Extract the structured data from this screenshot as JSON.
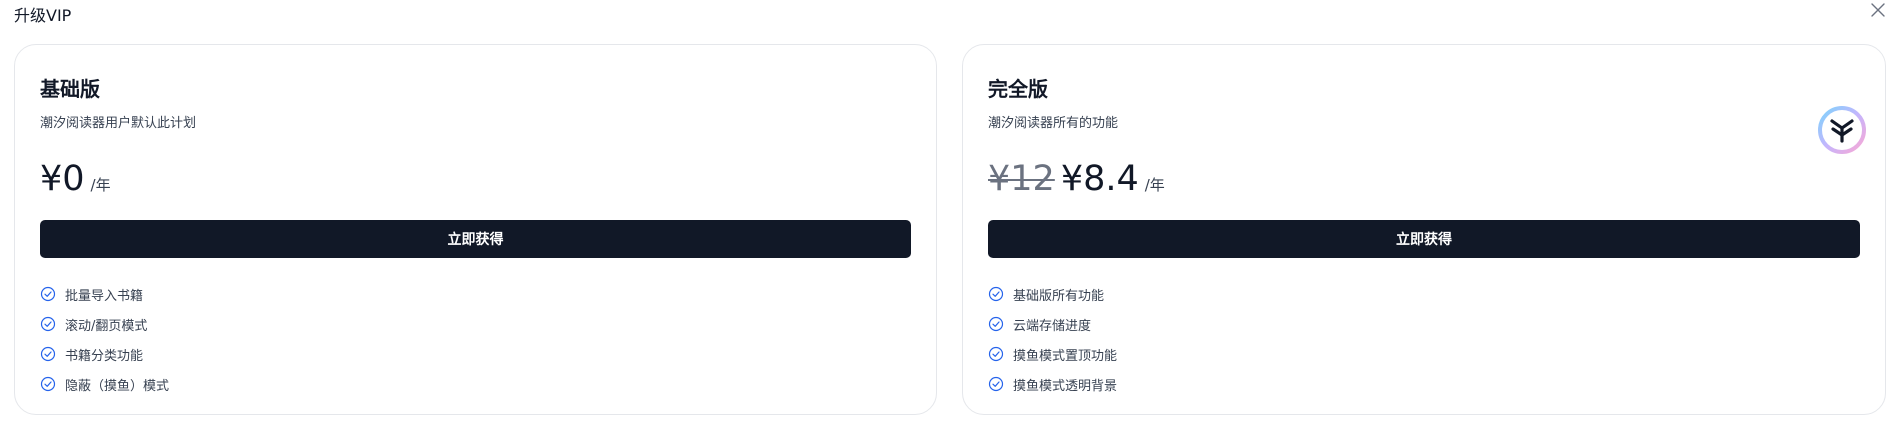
{
  "dialog": {
    "title": "升级VIP"
  },
  "plans": {
    "basic": {
      "name": "基础版",
      "description": "潮汐阅读器用户默认此计划",
      "price": "¥0",
      "per": "/年",
      "cta": "立即获得",
      "features": [
        "批量导入书籍",
        "滚动/翻页模式",
        "书籍分类功能",
        "隐蔽（摸鱼）模式"
      ]
    },
    "full": {
      "name": "完全版",
      "description": "潮汐阅读器所有的功能",
      "original_price": "¥12",
      "price": "¥8.4",
      "per": "/年",
      "cta": "立即获得",
      "features": [
        "基础版所有功能",
        "云端存储进度",
        "摸鱼模式置顶功能",
        "摸鱼模式透明背景"
      ]
    }
  },
  "colors": {
    "accent": "#2563eb",
    "button": "#111827",
    "border": "#e5e7eb"
  },
  "icons": {
    "close": "close-icon",
    "check": "check-circle-icon",
    "logo": "app-logo-icon"
  }
}
